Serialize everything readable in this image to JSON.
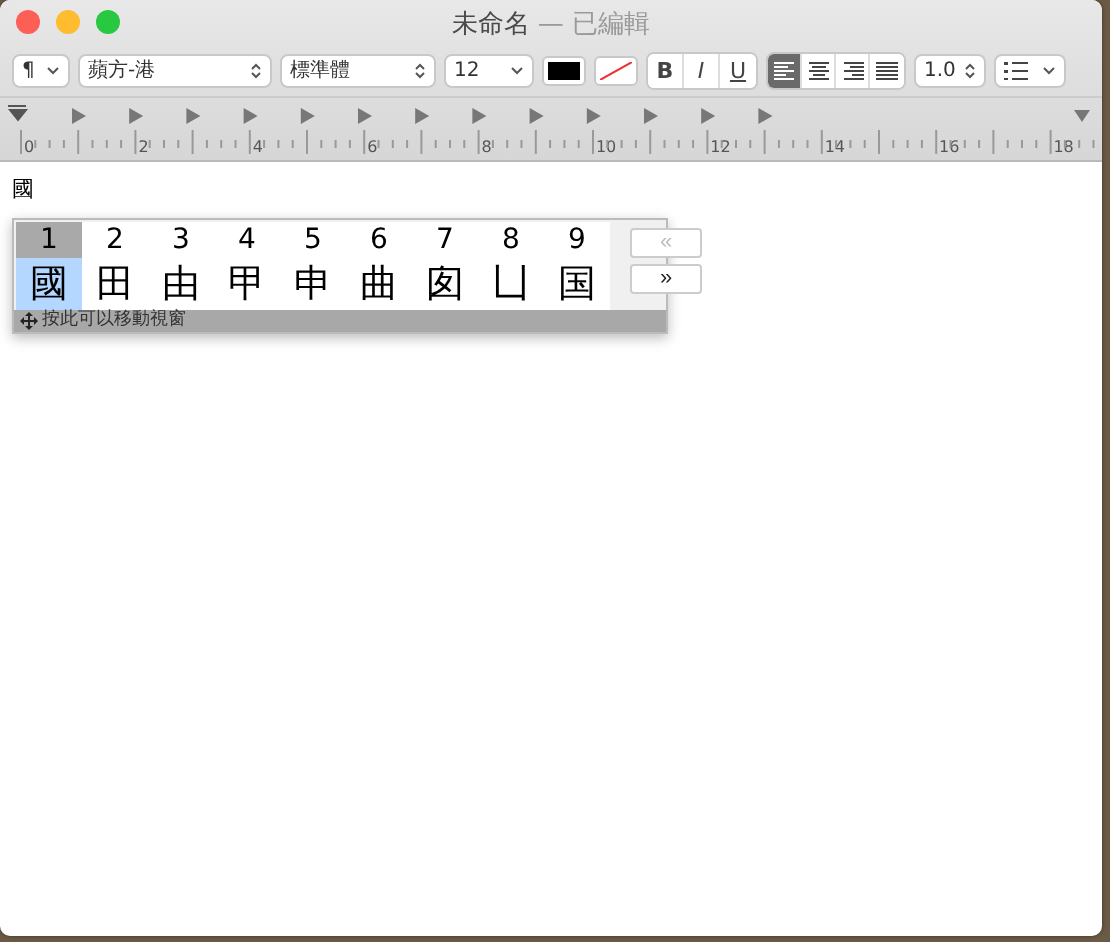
{
  "window": {
    "title": "未命名",
    "status": "— 已編輯"
  },
  "toolbar": {
    "paragraph_style": "¶",
    "font_family": "蘋方-港",
    "typeface": "標準體",
    "font_size": "12",
    "text_styles": [
      {
        "kind": "bold",
        "label": "B"
      },
      {
        "kind": "italic",
        "label": "I"
      },
      {
        "kind": "underline",
        "label": "U"
      }
    ],
    "alignments": [
      {
        "kind": "left",
        "selected": true
      },
      {
        "kind": "center",
        "selected": false
      },
      {
        "kind": "right",
        "selected": false
      },
      {
        "kind": "justify",
        "selected": false
      }
    ],
    "line_spacing": "1.0"
  },
  "ruler": {
    "labels": [
      "0",
      "2",
      "4",
      "6",
      "8",
      "10",
      "12",
      "14",
      "16",
      "18"
    ]
  },
  "document": {
    "text": "國"
  },
  "candidates": {
    "items": [
      {
        "number": "1",
        "char": "國",
        "selected": true
      },
      {
        "number": "2",
        "char": "田",
        "selected": false
      },
      {
        "number": "3",
        "char": "由",
        "selected": false
      },
      {
        "number": "4",
        "char": "甲",
        "selected": false
      },
      {
        "number": "5",
        "char": "申",
        "selected": false
      },
      {
        "number": "6",
        "char": "曲",
        "selected": false
      },
      {
        "number": "7",
        "char": "囱",
        "selected": false
      },
      {
        "number": "8",
        "char": "凵",
        "selected": false
      },
      {
        "number": "9",
        "char": "国",
        "selected": false
      }
    ],
    "previous_page": {
      "label": "«",
      "disabled": true
    },
    "next_page": {
      "label": "»",
      "disabled": false
    },
    "hint": "按此可以移動視窗"
  }
}
